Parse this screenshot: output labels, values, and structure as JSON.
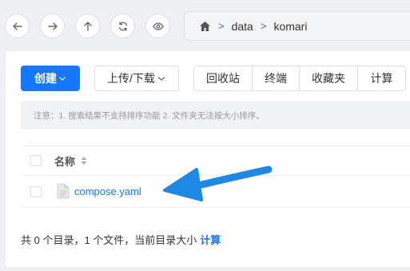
{
  "nav": {
    "back_icon": "arrow-left-icon",
    "forward_icon": "arrow-right-icon",
    "up_icon": "arrow-up-icon",
    "refresh_icon": "refresh-icon",
    "view_icon": "eye-icon"
  },
  "path": {
    "home_icon": "home-icon",
    "separator": ">",
    "segments": [
      "data",
      "komari"
    ]
  },
  "toolbar": {
    "create_label": "创建",
    "upload_label": "上传/下载",
    "group": [
      "回收站",
      "终端",
      "收藏夹",
      "计算"
    ],
    "accent": "#1677ff"
  },
  "notice": "注意：1. 搜索结果不支持排序功能 2. 文件夹无法按大小排序。",
  "table": {
    "header_name": "名称",
    "rows": [
      {
        "name": "compose.yaml",
        "icon": "file-icon"
      }
    ]
  },
  "footer": {
    "summary": "共 0 个目录，1 个文件，当前目录大小",
    "calc_link": "计算"
  },
  "annotation": {
    "arrow_color": "#1e88e5"
  }
}
